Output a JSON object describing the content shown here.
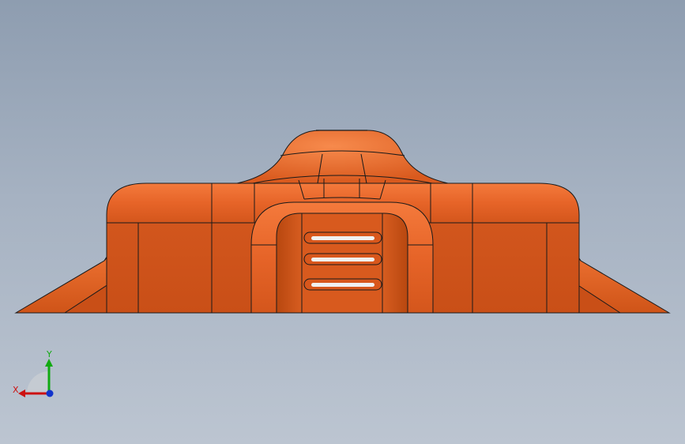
{
  "viewport": {
    "background_top": "#8e9db0",
    "background_bottom": "#bcc5d1"
  },
  "model": {
    "color_face": "#d8571c",
    "color_highlight": "#f07838",
    "color_shadow": "#b24510",
    "edge_color": "#1a1a1a",
    "icon": "orange-molded-part"
  },
  "triad": {
    "x_label": "X",
    "y_label": "Y",
    "x_color": "#cc1111",
    "y_color": "#11aa11",
    "z_color": "#1133cc"
  }
}
